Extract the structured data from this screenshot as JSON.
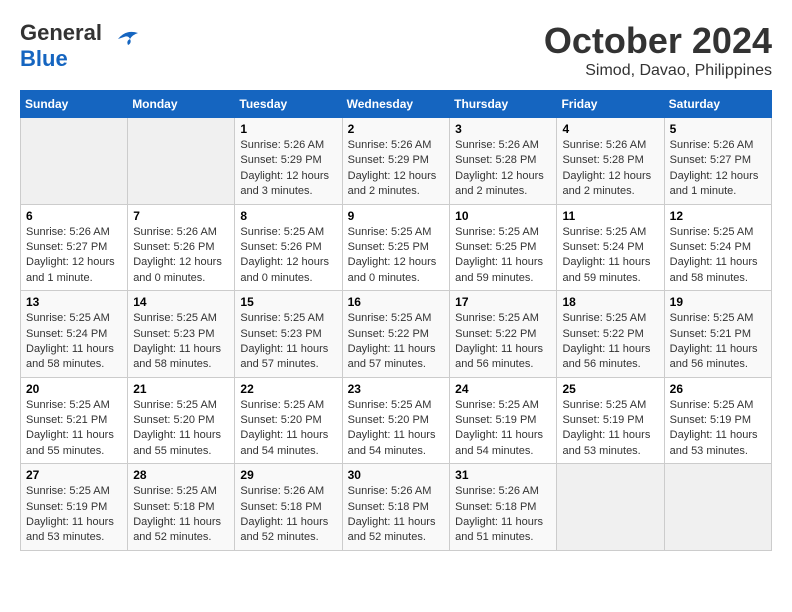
{
  "header": {
    "logo_line1": "General",
    "logo_line2": "Blue",
    "month": "October 2024",
    "location": "Simod, Davao, Philippines"
  },
  "weekdays": [
    "Sunday",
    "Monday",
    "Tuesday",
    "Wednesday",
    "Thursday",
    "Friday",
    "Saturday"
  ],
  "weeks": [
    [
      {
        "day": "",
        "info": ""
      },
      {
        "day": "",
        "info": ""
      },
      {
        "day": "1",
        "info": "Sunrise: 5:26 AM\nSunset: 5:29 PM\nDaylight: 12 hours and 3 minutes."
      },
      {
        "day": "2",
        "info": "Sunrise: 5:26 AM\nSunset: 5:29 PM\nDaylight: 12 hours and 2 minutes."
      },
      {
        "day": "3",
        "info": "Sunrise: 5:26 AM\nSunset: 5:28 PM\nDaylight: 12 hours and 2 minutes."
      },
      {
        "day": "4",
        "info": "Sunrise: 5:26 AM\nSunset: 5:28 PM\nDaylight: 12 hours and 2 minutes."
      },
      {
        "day": "5",
        "info": "Sunrise: 5:26 AM\nSunset: 5:27 PM\nDaylight: 12 hours and 1 minute."
      }
    ],
    [
      {
        "day": "6",
        "info": "Sunrise: 5:26 AM\nSunset: 5:27 PM\nDaylight: 12 hours and 1 minute."
      },
      {
        "day": "7",
        "info": "Sunrise: 5:26 AM\nSunset: 5:26 PM\nDaylight: 12 hours and 0 minutes."
      },
      {
        "day": "8",
        "info": "Sunrise: 5:25 AM\nSunset: 5:26 PM\nDaylight: 12 hours and 0 minutes."
      },
      {
        "day": "9",
        "info": "Sunrise: 5:25 AM\nSunset: 5:25 PM\nDaylight: 12 hours and 0 minutes."
      },
      {
        "day": "10",
        "info": "Sunrise: 5:25 AM\nSunset: 5:25 PM\nDaylight: 11 hours and 59 minutes."
      },
      {
        "day": "11",
        "info": "Sunrise: 5:25 AM\nSunset: 5:24 PM\nDaylight: 11 hours and 59 minutes."
      },
      {
        "day": "12",
        "info": "Sunrise: 5:25 AM\nSunset: 5:24 PM\nDaylight: 11 hours and 58 minutes."
      }
    ],
    [
      {
        "day": "13",
        "info": "Sunrise: 5:25 AM\nSunset: 5:24 PM\nDaylight: 11 hours and 58 minutes."
      },
      {
        "day": "14",
        "info": "Sunrise: 5:25 AM\nSunset: 5:23 PM\nDaylight: 11 hours and 58 minutes."
      },
      {
        "day": "15",
        "info": "Sunrise: 5:25 AM\nSunset: 5:23 PM\nDaylight: 11 hours and 57 minutes."
      },
      {
        "day": "16",
        "info": "Sunrise: 5:25 AM\nSunset: 5:22 PM\nDaylight: 11 hours and 57 minutes."
      },
      {
        "day": "17",
        "info": "Sunrise: 5:25 AM\nSunset: 5:22 PM\nDaylight: 11 hours and 56 minutes."
      },
      {
        "day": "18",
        "info": "Sunrise: 5:25 AM\nSunset: 5:22 PM\nDaylight: 11 hours and 56 minutes."
      },
      {
        "day": "19",
        "info": "Sunrise: 5:25 AM\nSunset: 5:21 PM\nDaylight: 11 hours and 56 minutes."
      }
    ],
    [
      {
        "day": "20",
        "info": "Sunrise: 5:25 AM\nSunset: 5:21 PM\nDaylight: 11 hours and 55 minutes."
      },
      {
        "day": "21",
        "info": "Sunrise: 5:25 AM\nSunset: 5:20 PM\nDaylight: 11 hours and 55 minutes."
      },
      {
        "day": "22",
        "info": "Sunrise: 5:25 AM\nSunset: 5:20 PM\nDaylight: 11 hours and 54 minutes."
      },
      {
        "day": "23",
        "info": "Sunrise: 5:25 AM\nSunset: 5:20 PM\nDaylight: 11 hours and 54 minutes."
      },
      {
        "day": "24",
        "info": "Sunrise: 5:25 AM\nSunset: 5:19 PM\nDaylight: 11 hours and 54 minutes."
      },
      {
        "day": "25",
        "info": "Sunrise: 5:25 AM\nSunset: 5:19 PM\nDaylight: 11 hours and 53 minutes."
      },
      {
        "day": "26",
        "info": "Sunrise: 5:25 AM\nSunset: 5:19 PM\nDaylight: 11 hours and 53 minutes."
      }
    ],
    [
      {
        "day": "27",
        "info": "Sunrise: 5:25 AM\nSunset: 5:19 PM\nDaylight: 11 hours and 53 minutes."
      },
      {
        "day": "28",
        "info": "Sunrise: 5:25 AM\nSunset: 5:18 PM\nDaylight: 11 hours and 52 minutes."
      },
      {
        "day": "29",
        "info": "Sunrise: 5:26 AM\nSunset: 5:18 PM\nDaylight: 11 hours and 52 minutes."
      },
      {
        "day": "30",
        "info": "Sunrise: 5:26 AM\nSunset: 5:18 PM\nDaylight: 11 hours and 52 minutes."
      },
      {
        "day": "31",
        "info": "Sunrise: 5:26 AM\nSunset: 5:18 PM\nDaylight: 11 hours and 51 minutes."
      },
      {
        "day": "",
        "info": ""
      },
      {
        "day": "",
        "info": ""
      }
    ]
  ]
}
